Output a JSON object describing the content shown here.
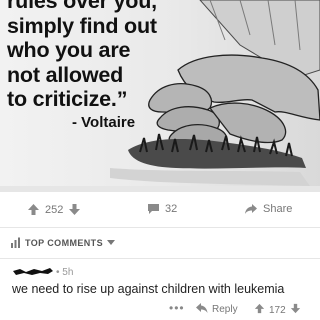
{
  "post": {
    "image": {
      "quote": "rules over you,\nsimply find out\nwho you are\nnot allowed\nto criticize.”",
      "author": "- Voltaire"
    },
    "actions": {
      "upvotes": "252",
      "comments": "32",
      "share_label": "Share"
    }
  },
  "comments_section": {
    "sort_label": "TOP COMMENTS"
  },
  "comment": {
    "age": "• 5h",
    "body": "we need to rise up against children with leukemia",
    "more": "•••",
    "reply_label": "Reply",
    "votes": "172"
  },
  "icons": {
    "upvote": "arrow-up-icon",
    "downvote": "arrow-down-icon",
    "comment": "comment-bubble-icon",
    "share": "share-arrow-icon",
    "sort": "bar-chart-icon",
    "reply": "reply-arrow-icon"
  },
  "colors": {
    "icon": "#8a8a8a",
    "text_muted": "#777777",
    "text": "#222222"
  }
}
